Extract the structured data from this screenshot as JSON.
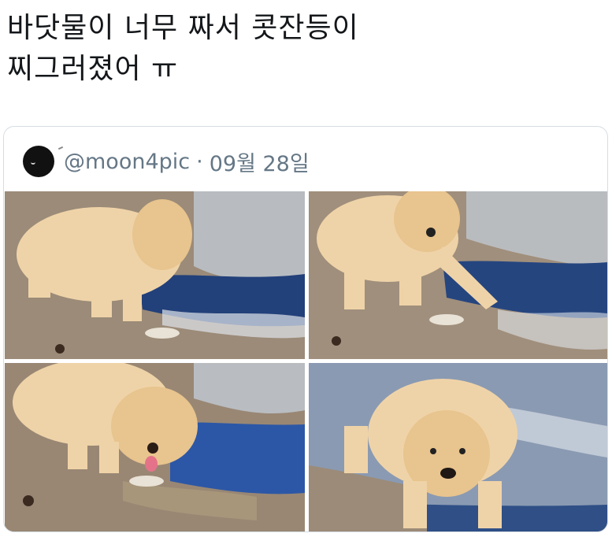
{
  "tweet": {
    "line1": "바닷물이 너무 짜서 콧잔등이",
    "line2": "찌그러졌어 ㅠ"
  },
  "quote": {
    "handle": "@moon4pic",
    "separator": "·",
    "date": "09월 28일",
    "photos": [
      {
        "name": "puppy-photo-1"
      },
      {
        "name": "puppy-photo-2"
      },
      {
        "name": "puppy-photo-3"
      },
      {
        "name": "puppy-photo-4"
      }
    ]
  },
  "colors": {
    "text": "#14171a",
    "muted": "#657786",
    "border": "#d6dde3",
    "sand": "#9c8b78",
    "sea": "#2f4f86",
    "puppy": "#efd3a8"
  }
}
